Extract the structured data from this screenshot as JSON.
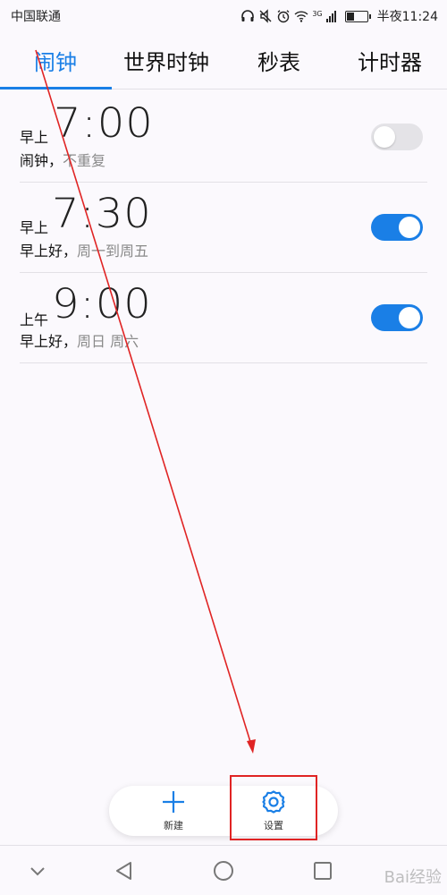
{
  "status_bar": {
    "carrier": "中国联通",
    "network_type": "3G",
    "time": "半夜11:24",
    "icons": [
      "headphones-icon",
      "mute-icon",
      "alarm-icon",
      "wifi-icon",
      "signal-icon",
      "battery-icon"
    ]
  },
  "tabs": [
    {
      "label": "闹钟",
      "active": true
    },
    {
      "label": "世界时钟",
      "active": false
    },
    {
      "label": "秒表",
      "active": false
    },
    {
      "label": "计时器",
      "active": false
    }
  ],
  "alarms": [
    {
      "period": "早上",
      "time": "7:00",
      "label": "闹钟，",
      "repeat": "不重复",
      "enabled": false
    },
    {
      "period": "早上",
      "time": "7:30",
      "label": "早上好，",
      "repeat": "周一到周五",
      "enabled": true
    },
    {
      "period": "上午",
      "time": "9:00",
      "label": "早上好，",
      "repeat": "周日 周六",
      "enabled": true
    }
  ],
  "actions": {
    "new_label": "新建",
    "new_icon": "plus-icon",
    "settings_label": "设置",
    "settings_icon": "gear-icon"
  },
  "nav": {
    "icons": [
      "chevron-down-icon",
      "back-icon",
      "home-icon",
      "recents-icon"
    ]
  },
  "watermark": "Bai经验",
  "colors": {
    "accent": "#1a7fe6",
    "annotation": "#e02424",
    "background": "#fbf9fd"
  }
}
